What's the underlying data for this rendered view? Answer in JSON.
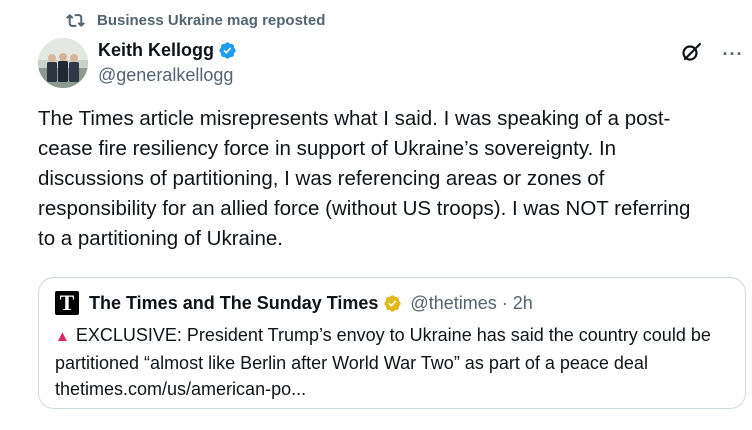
{
  "social_context": {
    "icon": "repost-icon",
    "text": "Business Ukraine mag reposted"
  },
  "author": {
    "display_name": "Keith Kellogg",
    "handle": "@generalkellogg",
    "verified": true,
    "verified_color": "#1d9bf0"
  },
  "actions": {
    "grok_icon": "grok-icon",
    "more_label": "···"
  },
  "post": {
    "text": "The Times article misrepresents what I said. I was speaking of a post-\ncease fire resiliency force in support of Ukraine’s sovereignty. In\ndiscussions of partitioning, I was referencing areas or zones of\nresponsibility for an allied force (without US troops). I was NOT referring\nto a partitioning of Ukraine."
  },
  "quote": {
    "logo_letter": "T",
    "display_name": "The Times and The Sunday Times",
    "verified_color": "#e2b719",
    "handle": "@thetimes",
    "separator": "·",
    "time": "2h",
    "marker": "▲",
    "text": "EXCLUSIVE: President Trump’s envoy to Ukraine has said the country could be partitioned “almost like Berlin after World War Two” as part of a peace deal",
    "link": "thetimes.com/us/american-po..."
  }
}
